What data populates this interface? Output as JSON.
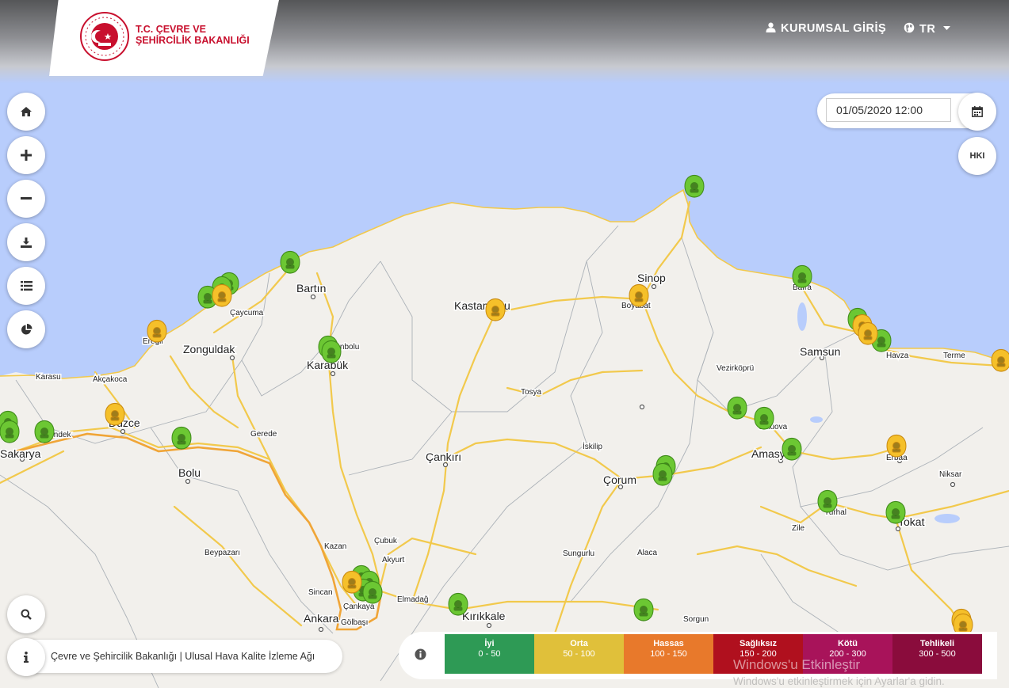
{
  "header": {
    "ministry_line1": "T.C. ÇEVRE VE",
    "ministry_line2": "ŞEHİRCİLİK BAKANLIĞI",
    "login_label": "KURUMSAL GİRİŞ",
    "language": "TR"
  },
  "controls": {
    "date_value": "01/05/2020 12:00",
    "hki_label": "HKI"
  },
  "footer": {
    "info_text": "Çevre ve Şehircilik Bakanlığı | Ulusal Hava Kalite İzleme Ağı"
  },
  "legend": [
    {
      "label": "İyi",
      "range": "0 - 50",
      "color": "#2e9a55"
    },
    {
      "label": "Orta",
      "range": "50 - 100",
      "color": "#e0c03a"
    },
    {
      "label": "Hassas",
      "range": "100 - 150",
      "color": "#e8792b"
    },
    {
      "label": "Sağlıksız",
      "range": "150 - 200",
      "color": "#b0101e"
    },
    {
      "label": "Kötü",
      "range": "200 - 300",
      "color": "#a8135a"
    },
    {
      "label": "Tehlikeli",
      "range": "300 - 500",
      "color": "#8a0c3c"
    }
  ],
  "watermark": {
    "line1": "Windows'u Etkinleştir",
    "line2": "Windows'u etkinleştirmek için Ayarlar'a gidin."
  },
  "map": {
    "sea_color": "#b8cdfc",
    "land_color": "#f2f0ec",
    "road_color": "#f2c94c",
    "cities": [
      "Bartın",
      "Kastamonu",
      "Sinop",
      "Boyabat",
      "Bafra",
      "Samsun",
      "Terme",
      "Çaycuma",
      "Zonguldak",
      "Safranbolu",
      "Karabük",
      "Ereğli",
      "Karasu",
      "Akçakoca",
      "Düzce",
      "Sakarya",
      "Hendek",
      "Bolu",
      "Gerede",
      "Tosya",
      "Vezirköprü",
      "Havza",
      "Çankırı",
      "İskilip",
      "Çorum",
      "Suluova",
      "Amasya",
      "Erbaa",
      "Niksar",
      "Tokat",
      "Turhal",
      "Zile",
      "Sungurlu",
      "Alaca",
      "Beypazarı",
      "Kazan",
      "Çubuk",
      "Akyurt",
      "Sincan",
      "Ankara",
      "Çankaya",
      "Gölbaşı",
      "Elmadağ",
      "Kırıkkale",
      "Sorgun"
    ],
    "stations": {
      "good_count": 27,
      "moderate_count": 12
    }
  }
}
